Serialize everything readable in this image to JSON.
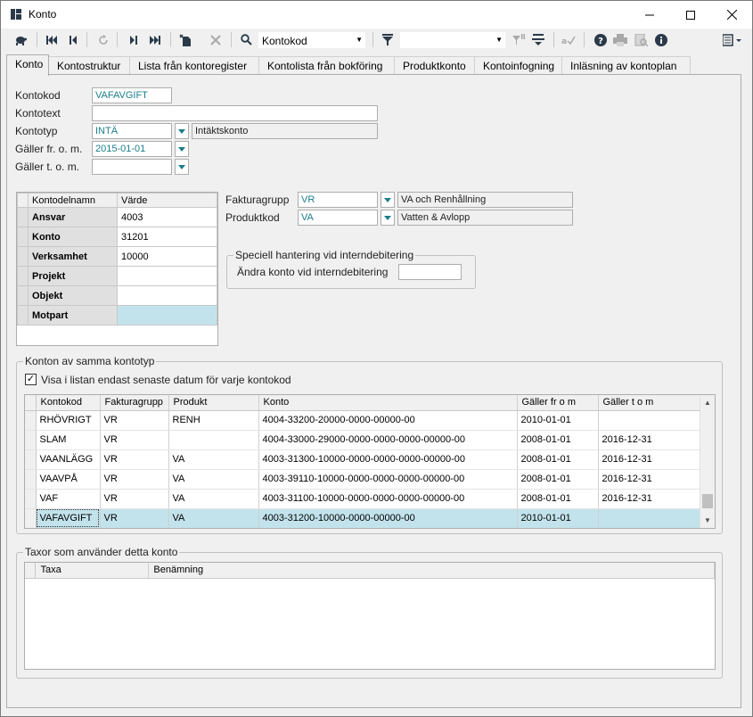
{
  "window": {
    "title": "Konto",
    "icon": "app-grid-icon"
  },
  "toolbar": {
    "search_combo_value": "Kontokod",
    "filter_combo_value": ""
  },
  "tabs": [
    {
      "label": "Konto"
    },
    {
      "label": "Kontostruktur"
    },
    {
      "label": "Lista från kontoregister"
    },
    {
      "label": "Kontolista från bokföring"
    },
    {
      "label": "Produktkonto"
    },
    {
      "label": "Kontoinfogning"
    },
    {
      "label": "Inläsning av kontoplan"
    }
  ],
  "form": {
    "kontokod_label": "Kontokod",
    "kontokod_value": "VAFAVGIFT",
    "kontotext_label": "Kontotext",
    "kontotext_value": "",
    "kontotyp_label": "Kontotyp",
    "kontotyp_value": "INTÄ",
    "kontotyp_desc": "Intäktskonto",
    "galler_from_label": "Gäller fr. o. m.",
    "galler_from_value": "2015-01-01",
    "galler_tom_label": "Gäller t. o. m.",
    "galler_tom_value": "",
    "fakturagrupp_label": "Fakturagrupp",
    "fakturagrupp_value": "VR",
    "fakturagrupp_desc": "VA och Renhållning",
    "produktkod_label": "Produktkod",
    "produktkod_value": "VA",
    "produktkod_desc": "Vatten & Avlopp"
  },
  "kontodel": {
    "headers": [
      "Kontodelnamn",
      "Värde"
    ],
    "rows": [
      {
        "name": "Ansvar",
        "value": "4003"
      },
      {
        "name": "Konto",
        "value": "31201"
      },
      {
        "name": "Verksamhet",
        "value": "10000"
      },
      {
        "name": "Projekt",
        "value": ""
      },
      {
        "name": "Objekt",
        "value": ""
      },
      {
        "name": "Motpart",
        "value": ""
      }
    ]
  },
  "special": {
    "title": "Speciell hantering vid interndebitering",
    "label": "Ändra konto vid interndebitering",
    "value": ""
  },
  "same_type": {
    "title": "Konton av samma kontotyp",
    "checkbox_label": "Visa i listan endast senaste datum för varje kontokod",
    "checkbox_checked": "✓",
    "headers": [
      "Kontokod",
      "Fakturagrupp",
      "Produkt",
      "Konto",
      "Gäller fr o m",
      "Gäller t o m"
    ],
    "rows": [
      {
        "kontokod": "RHÖVRIGT",
        "fakturagrupp": "VR",
        "produkt": "RENH",
        "konto": "4004-33200-20000-0000-00000-00",
        "from": "2010-01-01",
        "tom": ""
      },
      {
        "kontokod": "SLAM",
        "fakturagrupp": "VR",
        "produkt": "",
        "konto": "4004-33000-29000-0000-0000-0000-00000-00",
        "from": "2008-01-01",
        "tom": "2016-12-31"
      },
      {
        "kontokod": "VAANLÄGG",
        "fakturagrupp": "VR",
        "produkt": "VA",
        "konto": "4003-31300-10000-0000-0000-0000-00000-00",
        "from": "2008-01-01",
        "tom": "2016-12-31"
      },
      {
        "kontokod": "VAAVPÅ",
        "fakturagrupp": "VR",
        "produkt": "VA",
        "konto": "4003-39110-10000-0000-0000-0000-00000-00",
        "from": "2008-01-01",
        "tom": "2016-12-31"
      },
      {
        "kontokod": "VAF",
        "fakturagrupp": "VR",
        "produkt": "VA",
        "konto": "4003-31100-10000-0000-0000-0000-00000-00",
        "from": "2008-01-01",
        "tom": "2016-12-31"
      },
      {
        "kontokod": "VAFAVGIFT",
        "fakturagrupp": "VR",
        "produkt": "VA",
        "konto": "4003-31200-10000-0000-00000-00",
        "from": "2010-01-01",
        "tom": ""
      }
    ],
    "selected_index": 5
  },
  "taxor": {
    "title": "Taxor som använder detta konto",
    "headers": [
      "Taxa",
      "Benämning"
    ]
  },
  "colors": {
    "accent_teal": "#1c7e8c",
    "selection": "#c3e3ec"
  }
}
